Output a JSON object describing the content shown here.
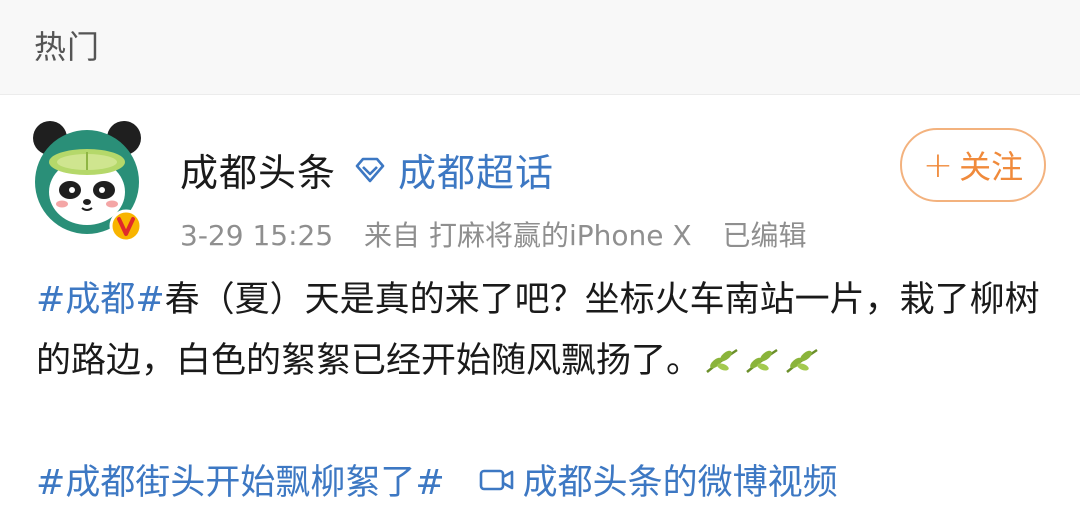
{
  "section": {
    "title": "热门"
  },
  "post": {
    "author": "成都头条",
    "topic": {
      "label": "成都超话",
      "icon": "diamond-icon"
    },
    "follow_button": {
      "plus": "+",
      "label": "关注"
    },
    "meta": {
      "time": "3-29 15:25",
      "source": "来自 打麻将赢的iPhone X",
      "edited": "已编辑"
    },
    "text": {
      "hashtag": "#成都#",
      "body": "春（夏）天是真的来了吧？坐标火车南站一片，栽了柳树的路边，白色的絮絮已经开始随风飘扬了。",
      "emoji_icon": "willow-leaf-icon"
    },
    "footer": {
      "hashtag": "#成都街头开始飘柳絮了#",
      "video_label": "成都头条的微博视频",
      "video_icon": "video-icon"
    }
  },
  "colors": {
    "link": "#3d78c3",
    "follow": "#f08a3b",
    "meta": "#8f8f8f"
  }
}
